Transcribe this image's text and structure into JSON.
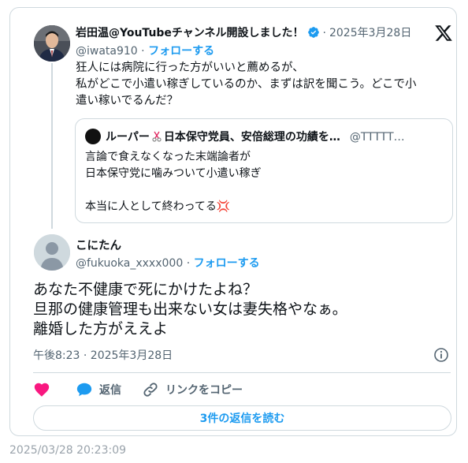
{
  "parent": {
    "name": "岩田温@YouTubeチャンネル開設しました！",
    "date": "2025年3月28日",
    "handle": "@iwata910",
    "separator": "·",
    "follow_label": "フォローする",
    "text_lines": [
      "狂人には病院に行った方がいいと薦めるが、",
      "私がどこで小遣い稼ぎしているのか、まずは訳を聞こう。どこで小",
      "遣い稼いでるんだ？"
    ]
  },
  "quote": {
    "name": "ルーパー",
    "name_rest": "日本保守党員、安倍総理の功績を…",
    "handle": "@TTTTT…",
    "text_lines": [
      "言論で食えなくなった末端論者が",
      "日本保守党に噛みついて小遣い稼ぎ",
      "",
      "本当に人として終わってる"
    ],
    "emoji": "💢"
  },
  "reply": {
    "name": "こにたん",
    "handle": "@fukuoka_xxxx000",
    "separator": "·",
    "follow_label": "フォローする",
    "text_lines": [
      "あなた不健康で死にかけたよね？",
      "旦那の健康管理も出来ない女は妻失格やなぁ。",
      "離婚した方がええよ"
    ],
    "time_date": "午後8:23 · 2025年3月28日"
  },
  "actions": {
    "reply_label": "返信",
    "copy_link_label": "リンクをコピー",
    "read_replies_label": "3件の返信を読む"
  },
  "screenshot_timestamp": "2025/03/28 20:23:09",
  "colors": {
    "accent": "#1d9bf0",
    "like": "#f91880",
    "border": "#cfd9de",
    "muted": "#536471"
  },
  "icons": [
    "verified-badge-icon",
    "x-logo-icon",
    "info-icon",
    "heart-icon",
    "reply-bubble-icon",
    "link-icon"
  ]
}
